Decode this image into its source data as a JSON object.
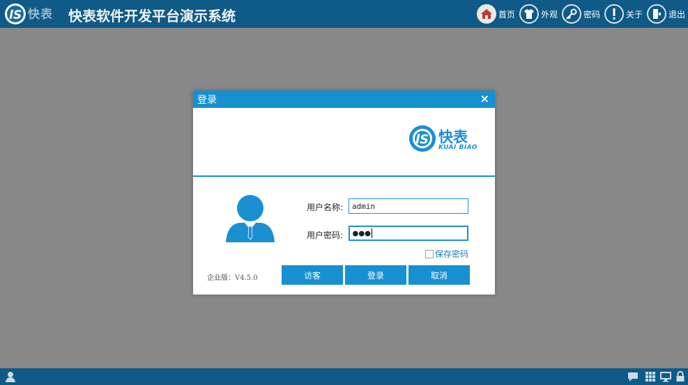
{
  "header": {
    "logo_text": "快表",
    "title": "快表软件开发平台演示系统",
    "nav": [
      {
        "icon": "home-icon",
        "label": "首页",
        "active": true
      },
      {
        "icon": "shirt-icon",
        "label": "外观"
      },
      {
        "icon": "key-icon",
        "label": "密码"
      },
      {
        "icon": "info-icon",
        "label": "关于"
      },
      {
        "icon": "logout-icon",
        "label": "退出"
      }
    ]
  },
  "dialog": {
    "title": "登录",
    "close_label": "×",
    "brand": {
      "name_cn": "快表",
      "name_en": "KUAI BIAO"
    },
    "username": {
      "label": "用户名称:",
      "value": "admin"
    },
    "password": {
      "label": "用户密码:",
      "value": "●●●"
    },
    "remember_label": "保存密码",
    "remember_checked": false,
    "version": "企业版：V4.5.0",
    "buttons": {
      "guest": "访客",
      "login": "登录",
      "cancel": "取消"
    }
  },
  "colors": {
    "header_bg": "#0f5a86",
    "accent": "#1690d0",
    "backdrop": "#888888"
  }
}
